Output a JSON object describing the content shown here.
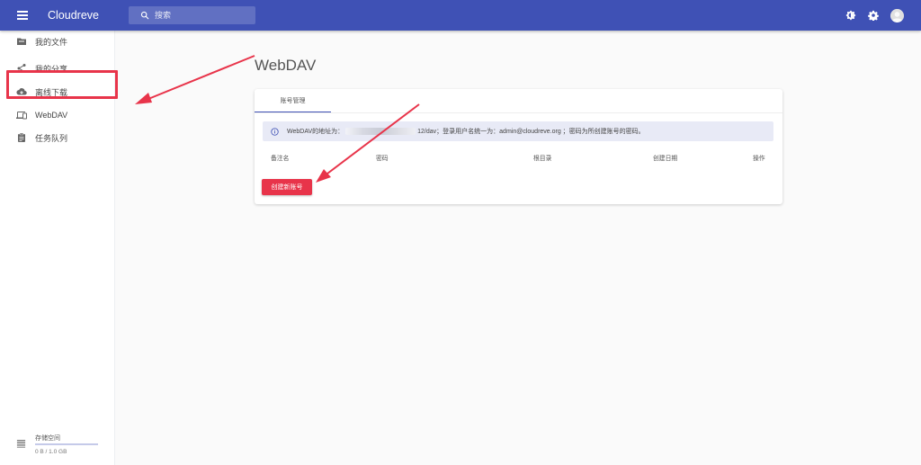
{
  "appbar": {
    "title": "Cloudreve",
    "search_placeholder": "搜索"
  },
  "sidebar": {
    "items": [
      {
        "label": "我的文件",
        "icon": "folder-icon"
      },
      {
        "label": "我的分享",
        "icon": "share-icon"
      },
      {
        "label": "离线下载",
        "icon": "cloud-download-icon"
      },
      {
        "label": "WebDAV",
        "icon": "devices-icon"
      },
      {
        "label": "任务队列",
        "icon": "clipboard-icon"
      }
    ],
    "storage": {
      "label": "存储空间",
      "value": "0 B / 1.0 GB",
      "used_fraction": 0.0
    }
  },
  "main": {
    "page_title": "WebDAV",
    "tab_label": "账号管理",
    "alert": {
      "prefix": "WebDAV的地址为：",
      "suffix": "12/dav；登录用户名统一为：admin@cloudreve.org ；密码为所创建账号的密码。"
    },
    "table_headers": [
      "备注名",
      "密码",
      "根目录",
      "创建日期",
      "操作"
    ],
    "create_button": "创建新账号"
  },
  "colors": {
    "primary": "#3f51b5",
    "accent": "#e8344a",
    "alert_bg": "#e8eaf6"
  }
}
